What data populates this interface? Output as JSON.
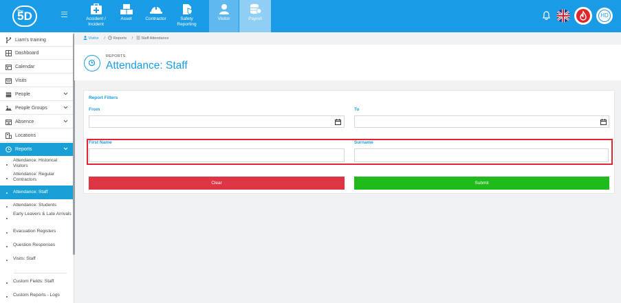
{
  "brand": {
    "logo_text": "5D",
    "logo_small": "The"
  },
  "modules": [
    {
      "id": "accident",
      "label": "Accident / Incident"
    },
    {
      "id": "asset",
      "label": "Asset"
    },
    {
      "id": "contractor",
      "label": "Contractor"
    },
    {
      "id": "safety",
      "label": "Safety Reporting"
    },
    {
      "id": "visitor",
      "label": "Visitor"
    },
    {
      "id": "payroll",
      "label": "Payroll"
    }
  ],
  "user": {
    "initials": "HD"
  },
  "colors": {
    "primary": "#1a9be6",
    "active_nav": "#18a0d6",
    "clear": "#de3545",
    "submit": "#21ba1c",
    "highlight": "#e32430"
  },
  "sidebar": {
    "top": [
      {
        "label": "Liam's training",
        "icon": "branch-icon"
      },
      {
        "label": "Dashboard",
        "icon": "dashboard-icon"
      },
      {
        "label": "Calendar",
        "icon": "calendar-icon"
      },
      {
        "label": "Visits",
        "icon": "visits-icon"
      },
      {
        "label": "People",
        "icon": "people-icon"
      },
      {
        "label": "People Groups",
        "icon": "people-groups-icon"
      },
      {
        "label": "Absence",
        "icon": "absence-icon"
      },
      {
        "label": "Locations",
        "icon": "locations-icon"
      },
      {
        "label": "Reports",
        "icon": "reports-icon"
      }
    ],
    "sub": [
      "Attendance: Historical Visitors",
      "Attendance: Regular Contractors",
      "Attendance: Staff",
      "Attendance: Students",
      "Early Leavers & Late Arrivals",
      "Evacuation Registers",
      "Question Responses",
      "Visits: Staff",
      "Custom Fields: Staff",
      "Custom Reports - Logs"
    ]
  },
  "breadcrumb": [
    "Visitor",
    "Reports",
    "Staff Attendance"
  ],
  "page": {
    "eyebrow": "REPORTS",
    "title": "Attendance: Staff"
  },
  "filters": {
    "heading": "Report Filters",
    "from_label": "From",
    "from_value": "",
    "to_label": "To",
    "to_value": "",
    "first_name_label": "First Name",
    "first_name_value": "",
    "surname_label": "Surname",
    "surname_value": ""
  },
  "buttons": {
    "clear": "Clear",
    "submit": "Submit"
  }
}
